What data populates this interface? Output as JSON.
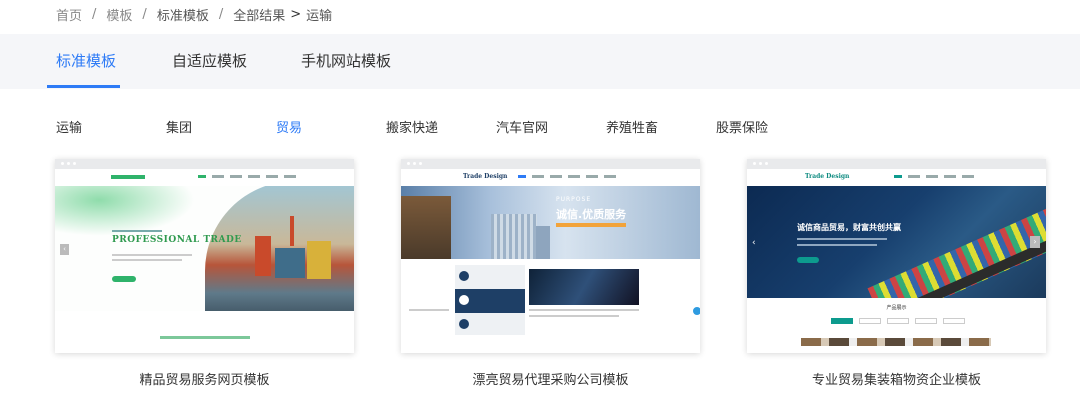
{
  "breadcrumb": {
    "items": [
      "首页",
      "模板",
      "标准模板",
      "全部结果"
    ],
    "current": "运输"
  },
  "tabs": [
    {
      "label": "标准模板",
      "active": true
    },
    {
      "label": "自适应模板",
      "active": false
    },
    {
      "label": "手机网站模板",
      "active": false
    }
  ],
  "categories": [
    {
      "label": "运输",
      "active": false
    },
    {
      "label": "集团",
      "active": false
    },
    {
      "label": "贸易",
      "active": true
    },
    {
      "label": "搬家快递",
      "active": false
    },
    {
      "label": "汽车官网",
      "active": false
    },
    {
      "label": "养殖牲畜",
      "active": false
    },
    {
      "label": "股票保险",
      "active": false
    }
  ],
  "cards": [
    {
      "title": "精品贸易服务网页模板",
      "hero_heading": "PROFESSIONAL TRADE",
      "accent": "#2fb36b"
    },
    {
      "title": "漂亮贸易代理采购公司模板",
      "logo": "Trade Design",
      "hero_heading": "诚信.优质服务",
      "hero_sub": "PURPOSE",
      "accent": "#1e3f66"
    },
    {
      "title": "专业贸易集装箱物资企业模板",
      "logo": "Trade Design",
      "hero_heading": "诚信商品贸易，财富共创共赢",
      "section_label": "产品展示",
      "accent": "#0d9b8e"
    }
  ],
  "colors": {
    "accent": "#2e7bf6",
    "band": "#f5f6f9"
  }
}
